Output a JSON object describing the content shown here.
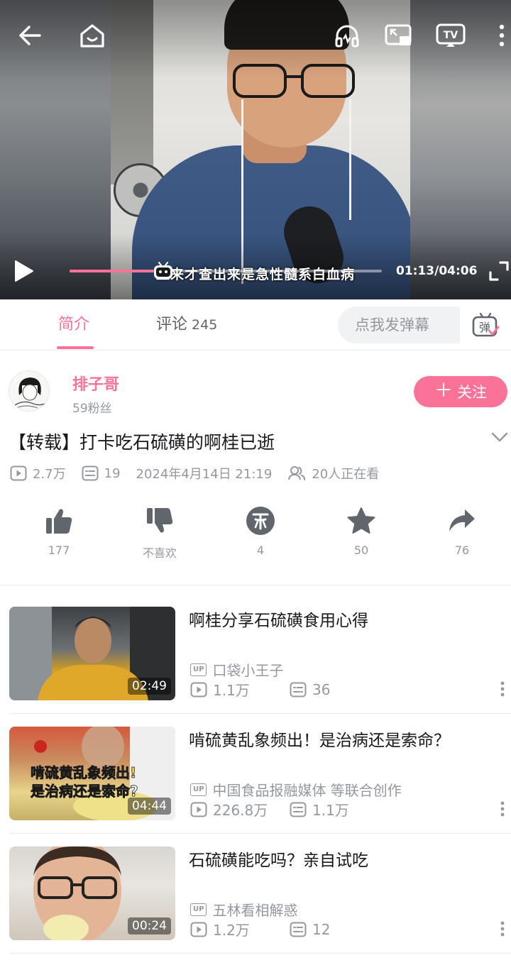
{
  "player": {
    "subtitle": "血来才查出来是急性髓系白血病",
    "current_time": "01:13",
    "total_time": "04:06",
    "time_display": "01:13/04:06",
    "progress_fraction": 0.3,
    "accent_color": "#fb7299"
  },
  "tabs": {
    "intro_label": "简介",
    "comment_label": "评论",
    "comment_count": "245",
    "danmaku_placeholder": "点我发弹幕",
    "danmaku_icon_char": "弹"
  },
  "uploader": {
    "name": "排子哥",
    "fans": "59粉丝",
    "follow_label": "关注"
  },
  "video": {
    "title": "【转载】打卡吃石硫磺的啊桂已逝",
    "views": "2.7万",
    "danmaku_count": "19",
    "date": "2024年4月14日 21:19",
    "watching": "20人正在看"
  },
  "actions": {
    "like": "177",
    "dislike": "不喜欢",
    "coin": "4",
    "favorite": "50",
    "share": "76"
  },
  "related": [
    {
      "title": "啊桂分享石硫磺食用心得",
      "duration": "02:49",
      "up_badge": "UP",
      "uploader": "口袋小王子",
      "views": "1.1万",
      "danmaku": "36"
    },
    {
      "title": "啃硫黄乱象频出！是治病还是索命？",
      "duration": "04:44",
      "up_badge": "UP",
      "uploader": "中国食品报融媒体 等联合创作",
      "views": "226.8万",
      "danmaku": "1.1万",
      "thumb_caption_1": "啃硫黄乱象频出!",
      "thumb_caption_2": "是治病还是索命?"
    },
    {
      "title": "石硫磺能吃吗？亲自试吃",
      "duration": "00:24",
      "up_badge": "UP",
      "uploader": "五林看相解惑",
      "views": "1.2万",
      "danmaku": "12"
    }
  ]
}
